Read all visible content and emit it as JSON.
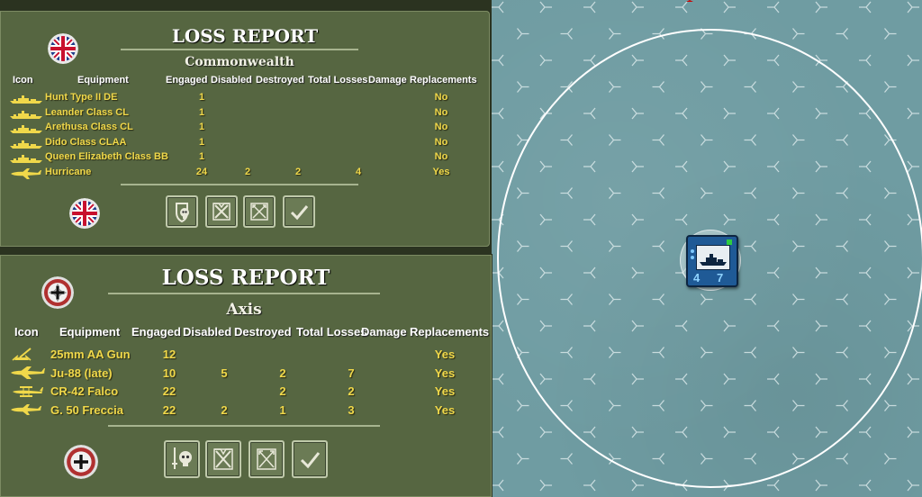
{
  "map": {
    "unit": {
      "stat_left": "4",
      "stat_right": "7"
    }
  },
  "commonwealth": {
    "title": "LOSS REPORT",
    "side": "Commonwealth",
    "headers": [
      "Icon",
      "Equipment",
      "Engaged",
      "Disabled",
      "Destroyed",
      "Total Losses",
      "Damage",
      "Replacements"
    ],
    "rows": [
      {
        "icon": "ship-icon",
        "equipment": "Hunt Type II DE",
        "engaged": "1",
        "disabled": "",
        "destroyed": "",
        "total": "",
        "damage": "",
        "replacements": "No"
      },
      {
        "icon": "ship-icon",
        "equipment": "Leander Class CL",
        "engaged": "1",
        "disabled": "",
        "destroyed": "",
        "total": "",
        "damage": "",
        "replacements": "No"
      },
      {
        "icon": "ship-icon",
        "equipment": "Arethusa Class CL",
        "engaged": "1",
        "disabled": "",
        "destroyed": "",
        "total": "",
        "damage": "",
        "replacements": "No"
      },
      {
        "icon": "ship-icon",
        "equipment": "Dido Class CLAA",
        "engaged": "1",
        "disabled": "",
        "destroyed": "",
        "total": "",
        "damage": "",
        "replacements": "No"
      },
      {
        "icon": "ship-icon",
        "equipment": "Queen Elizabeth Class BB",
        "engaged": "1",
        "disabled": "",
        "destroyed": "",
        "total": "",
        "damage": "",
        "replacements": "No"
      },
      {
        "icon": "fighter-plane-icon",
        "equipment": "Hurricane",
        "engaged": "24",
        "disabled": "2",
        "destroyed": "2",
        "total": "4",
        "damage": "",
        "replacements": "Yes"
      }
    ]
  },
  "axis": {
    "title": "LOSS REPORT",
    "side": "Axis",
    "headers": [
      "Icon",
      "Equipment",
      "Engaged",
      "Disabled",
      "Destroyed",
      "Total Losses",
      "Damage",
      "Replacements"
    ],
    "rows": [
      {
        "icon": "aa-gun-icon",
        "equipment": "25mm AA Gun",
        "engaged": "12",
        "disabled": "",
        "destroyed": "",
        "total": "",
        "damage": "",
        "replacements": "Yes"
      },
      {
        "icon": "bomber-plane-icon",
        "equipment": "Ju-88 (late)",
        "engaged": "10",
        "disabled": "5",
        "destroyed": "2",
        "total": "7",
        "damage": "",
        "replacements": "Yes"
      },
      {
        "icon": "biplane-icon",
        "equipment": "CR-42 Falco",
        "engaged": "22",
        "disabled": "",
        "destroyed": "2",
        "total": "2",
        "damage": "",
        "replacements": "Yes"
      },
      {
        "icon": "fighter-plane-icon",
        "equipment": "G. 50 Freccia",
        "engaged": "22",
        "disabled": "2",
        "destroyed": "1",
        "total": "3",
        "damage": "",
        "replacements": "Yes"
      }
    ]
  },
  "colors": {
    "panel": "#566641",
    "value_text": "#f0d84a",
    "header_text": "#ffffff",
    "sea": "#6f9ca2"
  }
}
